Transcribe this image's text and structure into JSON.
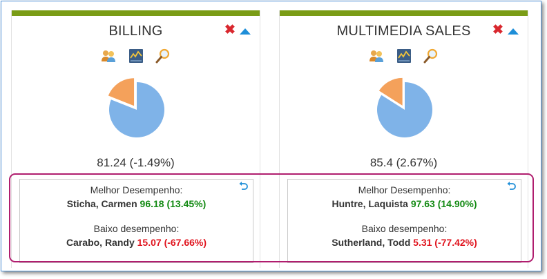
{
  "colors": {
    "accent_bar": "#7a9c16",
    "good": "#138a13",
    "bad": "#e0141e",
    "highlight": "#b01d6e",
    "pie_main": "#7fb3e8",
    "pie_slice": "#f4a15b"
  },
  "icons": [
    "close-icon",
    "collapse-up-icon",
    "users-icon",
    "chart-icon",
    "search-icon",
    "undo-icon"
  ],
  "cards": [
    {
      "title": "BILLING",
      "metric": "81.24 (-1.49%)",
      "pie_fraction_small": 0.19,
      "best_label": "Melhor Desempenho:",
      "best_name": "Sticha, Carmen",
      "best_value": "96.18 (13.45%)",
      "low_label": "Baixo desempenho:",
      "low_name": "Carabo, Randy",
      "low_value": "15.07 (-67.66%)"
    },
    {
      "title": "MULTIMEDIA SALES",
      "metric": "85.4 (2.67%)",
      "pie_fraction_small": 0.16,
      "best_label": "Melhor Desempenho:",
      "best_name": "Huntre, Laquista",
      "best_value": "97.63 (14.90%)",
      "low_label": "Baixo desempenho:",
      "low_name": "Sutherland, Todd",
      "low_value": "5.31 (-77.42%)"
    }
  ]
}
